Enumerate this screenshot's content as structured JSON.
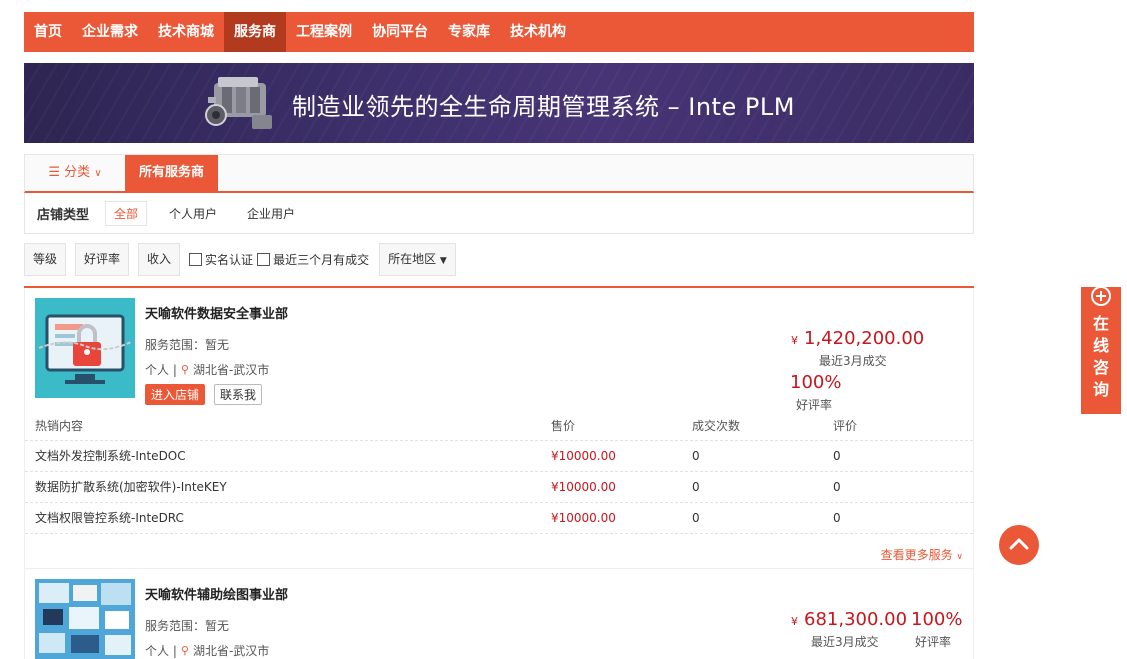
{
  "nav": {
    "items": [
      "首页",
      "企业需求",
      "技术商城",
      "服务商",
      "工程案例",
      "协同平台",
      "专家库",
      "技术机构"
    ],
    "active_index": 3
  },
  "banner": {
    "text": "制造业领先的全生命周期管理系统 – Inte PLM"
  },
  "category": {
    "toggle_label": "分类",
    "all_label": "所有服务商"
  },
  "shop_type": {
    "label": "店铺类型",
    "options": [
      "全部",
      "个人用户",
      "企业用户"
    ],
    "selected": "全部"
  },
  "filters": {
    "buttons": [
      "等级",
      "好评率",
      "收入"
    ],
    "checkboxes": [
      "实名认证",
      "最近三个月有成交"
    ],
    "region_label": "所在地区"
  },
  "stores": [
    {
      "name": "天喻软件数据安全事业部",
      "scope": "服务范围：暂无",
      "type": "个人",
      "location": "湖北省-武汉市",
      "enter_label": "进入店铺",
      "contact_label": "联系我",
      "currency": "¥",
      "amount": "1,420,200.00",
      "amount_label": "最近3月成交",
      "rating": "100%",
      "rating_label": "好评率",
      "table_headers": [
        "热销内容",
        "售价",
        "成交次数",
        "评价"
      ],
      "products": [
        {
          "name": "文档外发控制系统-InteDOC",
          "price": "¥10000.00",
          "deals": "0",
          "reviews": "0"
        },
        {
          "name": "数据防扩散系统(加密软件)-InteKEY",
          "price": "¥10000.00",
          "deals": "0",
          "reviews": "0"
        },
        {
          "name": "文档权限管控系统-InteDRC",
          "price": "¥10000.00",
          "deals": "0",
          "reviews": "0"
        }
      ],
      "more_label": "查看更多服务"
    },
    {
      "name": "天喻软件辅助绘图事业部",
      "scope": "服务范围：暂无",
      "type": "个人",
      "location": "湖北省-武汉市",
      "currency": "¥",
      "amount": "681,300.00",
      "amount_label": "最近3月成交",
      "rating": "100%",
      "rating_label": "好评率"
    }
  ],
  "side": {
    "online_label": "在线咨询"
  },
  "colors": {
    "accent": "#eb5837",
    "price": "#c8161d",
    "nav_active": "#b23a1e"
  }
}
